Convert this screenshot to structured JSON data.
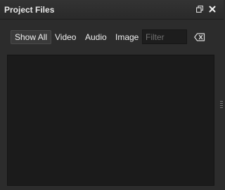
{
  "window": {
    "title": "Project Files",
    "controls": [
      {
        "name": "restore-icon",
        "icon": "restore-window-icon"
      },
      {
        "name": "close-icon",
        "icon": "close-icon"
      }
    ]
  },
  "toolbar": {
    "filters": [
      {
        "label": "Show All",
        "active": true
      },
      {
        "label": "Video",
        "active": false
      },
      {
        "label": "Audio",
        "active": false
      },
      {
        "label": "Image",
        "active": false
      }
    ],
    "search": {
      "placeholder": "Filter",
      "value": ""
    },
    "clear_icon": "clear-input-icon"
  },
  "file_list": {
    "items": []
  },
  "colors": {
    "panel_bg": "#2c2c2c",
    "list_bg": "#1b1b1b",
    "text": "#f0f0f0",
    "placeholder": "#6f6f6f"
  }
}
